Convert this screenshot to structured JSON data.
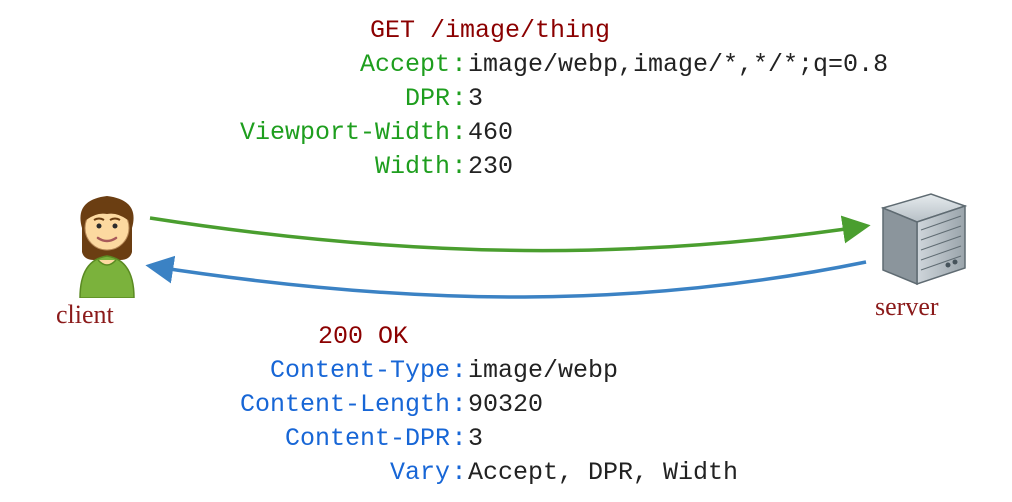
{
  "client_label": "client",
  "server_label": "server",
  "request": {
    "start_line": "GET /image/thing",
    "headers": [
      {
        "name": "Accept",
        "value": "image/webp,image/*,*/*;q=0.8"
      },
      {
        "name": "DPR",
        "value": "3"
      },
      {
        "name": "Viewport-Width",
        "value": "460"
      },
      {
        "name": "Width",
        "value": "230"
      }
    ]
  },
  "response": {
    "status_line": "200 OK",
    "headers": [
      {
        "name": "Content-Type",
        "value": "image/webp"
      },
      {
        "name": "Content-Length",
        "value": "90320"
      },
      {
        "name": "Content-DPR",
        "value": "3"
      },
      {
        "name": "Vary",
        "value": "Accept, DPR, Width"
      }
    ]
  },
  "colors": {
    "request_header": "#1e9e1e",
    "response_header": "#1766d6",
    "title": "#8b0000",
    "caption": "#8b1a1a",
    "arrow_out": "#4a9e2f",
    "arrow_in": "#3b82c4"
  }
}
